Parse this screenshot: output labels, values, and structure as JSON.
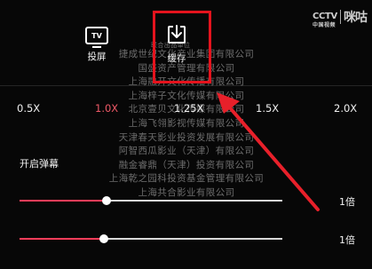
{
  "watermark": {
    "brand": "CCTV",
    "sub": "中国视频",
    "partner": "咪咕"
  },
  "actions": {
    "screencast_label": "投屏",
    "download_label": "缓存",
    "tv_icon_text": "TV"
  },
  "credits": {
    "header": "联合出品单位",
    "lines": [
      "捷成世纪文化产业集团有限公司",
      "国盛资产管理有限公司",
      "上海融开文化传播有限公司",
      "上海梓子文化传媒有限公司",
      "北京壹贝文化传媒有限公司",
      "上海飞翎影视传媒有限公司",
      "天津春天影业投资发展有限公司",
      "阿智西瓜影业（天津）有限公司",
      "融金睿鼎（天津）投资有限公司",
      "上海乾之园科投资基金管理有限公司",
      "上海共合影业有限公司"
    ]
  },
  "speeds": {
    "options": [
      "0.5X",
      "1.0X",
      "1.25X",
      "1.5X",
      "2.0X"
    ],
    "selected": "1.0X",
    "selected_color": "#ef5a68"
  },
  "danmaku": {
    "label": "开启弹幕",
    "sliders": [
      {
        "value_label": "1倍",
        "level": 0.33
      },
      {
        "value_label": "1倍",
        "level": 0.32
      }
    ]
  },
  "colors": {
    "highlight": "#e5131d",
    "slider_fill": "#ff3d5a"
  }
}
